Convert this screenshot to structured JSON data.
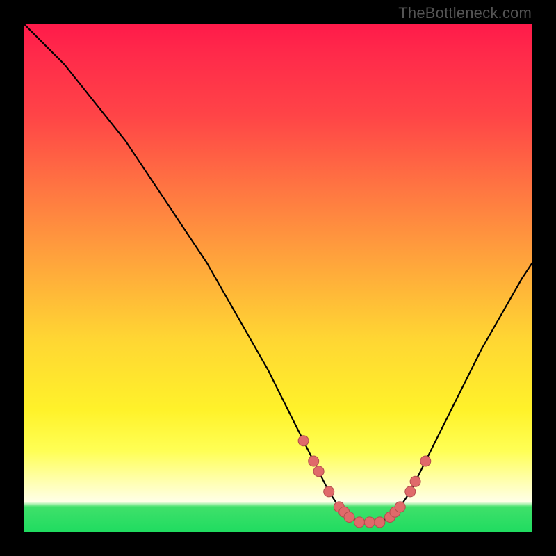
{
  "watermark": "TheBottleneck.com",
  "chart_data": {
    "type": "line",
    "title": "",
    "xlabel": "",
    "ylabel": "",
    "xlim": [
      0,
      100
    ],
    "ylim": [
      0,
      100
    ],
    "curve": {
      "x": [
        0,
        4,
        8,
        12,
        16,
        20,
        24,
        28,
        32,
        36,
        40,
        44,
        48,
        52,
        56,
        58,
        60,
        62,
        64,
        66,
        68,
        70,
        72,
        74,
        76,
        78,
        82,
        86,
        90,
        94,
        98,
        100
      ],
      "y": [
        100,
        96,
        92,
        87,
        82,
        77,
        71,
        65,
        59,
        53,
        46,
        39,
        32,
        24,
        16,
        12,
        8,
        5,
        3,
        2,
        2,
        2,
        3,
        5,
        8,
        12,
        20,
        28,
        36,
        43,
        50,
        53
      ]
    },
    "points": {
      "x": [
        55,
        57,
        58,
        60,
        62,
        63,
        64,
        66,
        68,
        70,
        72,
        73,
        74,
        76,
        77,
        79
      ],
      "y": [
        18,
        14,
        12,
        8,
        5,
        4,
        3,
        2,
        2,
        2,
        3,
        4,
        5,
        8,
        10,
        14
      ]
    },
    "colors": {
      "curve": "#000000",
      "point_fill": "#e06a6a",
      "point_stroke": "#b34d4d"
    }
  }
}
